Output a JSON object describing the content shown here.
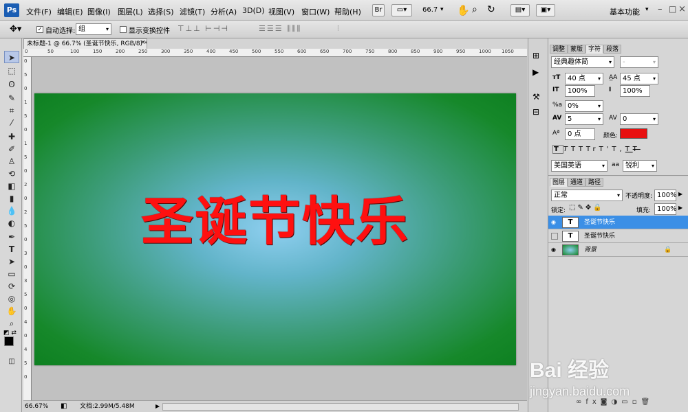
{
  "app": {
    "logo": "Ps",
    "workspace": "基本功能",
    "zoom_box": "66.7"
  },
  "menu": [
    "文件(F)",
    "编辑(E)",
    "图像(I)",
    "图层(L)",
    "选择(S)",
    "滤镜(T)",
    "分析(A)",
    "3D(D)",
    "视图(V)",
    "窗口(W)",
    "帮助(H)"
  ],
  "options": {
    "auto_select_label": "自动选择:",
    "auto_select_value": "组",
    "show_transform_label": "显示变换控件"
  },
  "document": {
    "tab_title": "未标题-1 @ 66.7% (圣诞节快乐, RGB/8) *",
    "canvas_text": "圣诞节快乐",
    "canvas_text_color": "#ff1010"
  },
  "rulers": {
    "top": [
      "0",
      "50",
      "100",
      "150",
      "200",
      "250",
      "300",
      "350",
      "400",
      "450",
      "500",
      "550",
      "600",
      "650",
      "700",
      "750",
      "800",
      "850",
      "900",
      "950",
      "1000",
      "1050"
    ],
    "left": [
      "0",
      "5",
      "0",
      "1",
      "5",
      "0",
      "1",
      "5",
      "0",
      "2",
      "0",
      "2",
      "5",
      "0",
      "3",
      "0",
      "3",
      "5",
      "0",
      "4",
      "0",
      "4",
      "5",
      "0"
    ]
  },
  "status": {
    "zoom": "66.67%",
    "doc": "文档:2.99M/5.48M"
  },
  "char_panel": {
    "tabs": [
      "调整",
      "蒙版",
      "字符",
      "段落"
    ],
    "font_family": "经典趣体简",
    "font_style": "-",
    "font_size": "40 点",
    "leading": "45 点",
    "vscale": "100%",
    "hscale": "100%",
    "tsume": "0%",
    "kerning": "5",
    "tracking": "0",
    "baseline": "0 点",
    "color_label": "颜色:",
    "color": "#e81010",
    "style_buttons": [
      "T",
      "T",
      "TT",
      "Tr",
      "T'",
      "T,",
      "T",
      "T"
    ],
    "language": "美国英语",
    "aa_label": "aa",
    "antialias": "锐利"
  },
  "layers_panel": {
    "tabs": [
      "图层",
      "通道",
      "路径"
    ],
    "blend_mode": "正常",
    "opacity_label": "不透明度:",
    "opacity": "100%",
    "lock_label": "锁定:",
    "fill_label": "填充:",
    "fill": "100%",
    "layers": [
      {
        "name": "圣诞节快乐",
        "type": "T",
        "visible": true,
        "selected": true
      },
      {
        "name": "圣诞节快乐",
        "type": "T",
        "visible": false,
        "selected": false
      },
      {
        "name": "背景",
        "type": "image",
        "visible": true,
        "selected": false,
        "locked": true
      }
    ]
  },
  "watermark": {
    "brand": "Bai 经验",
    "url": "jingyan.baidu.com"
  }
}
